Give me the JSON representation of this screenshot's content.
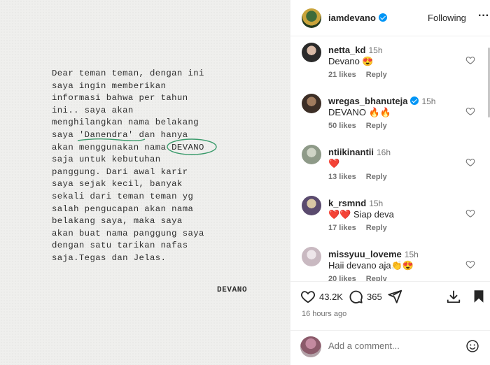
{
  "post": {
    "letter_lines": [
      "Dear teman teman, dengan ini",
      "saya ingin memberikan",
      "informasi bahwa per tahun",
      "ini.. saya akan",
      "menghilangkan nama belakang",
      "saya 'Danendra' dan hanya",
      "akan menggunakan nama DEVANO",
      "saja untuk kebutuhan",
      "panggung. Dari awal karir",
      "saya sejak kecil, banyak",
      "sekali dari teman teman yg",
      "salah pengucapan akan nama",
      "belakang saya, maka saya",
      "akan buat nama panggung saya",
      "dengan satu tarikan nafas",
      "saja.Tegas dan Jelas."
    ],
    "line6_prefix": "saya ",
    "line6_mark": "'Danendra'",
    "line6_suffix": " dan hanya",
    "line7_prefix": "akan menggunakan nama ",
    "line7_mark": "DEVANO",
    "signature": "DEVANO",
    "mark_color": "#3a9b6b"
  },
  "header": {
    "username": "iamdevano",
    "follow_label": "Following",
    "more_label": "···"
  },
  "comments": [
    {
      "user": "netta_kd",
      "verified": false,
      "time": "15h",
      "text": "Devano 😍",
      "likes": "21 likes",
      "reply": "Reply",
      "avatar_colors": [
        "#2a2a2a",
        "#d7b9a6"
      ]
    },
    {
      "user": "wregas_bhanuteja",
      "verified": true,
      "time": "15h",
      "text": "DEVANO 🔥🔥",
      "likes": "50 likes",
      "reply": "Reply",
      "avatar_colors": [
        "#3c2e26",
        "#a07b5e"
      ]
    },
    {
      "user": "ntiikinantii",
      "verified": false,
      "time": "16h",
      "text": "❤️",
      "likes": "13 likes",
      "reply": "Reply",
      "avatar_colors": [
        "#8e9a88",
        "#cfd4c6"
      ]
    },
    {
      "user": "k_rsmnd",
      "verified": false,
      "time": "15h",
      "text": "❤️❤️ Siap deva",
      "likes": "17 likes",
      "reply": "Reply",
      "avatar_colors": [
        "#5a4a6e",
        "#d8c6a4"
      ]
    },
    {
      "user": "missyuu_loveme",
      "verified": false,
      "time": "15h",
      "text": "Haii devano aja👏😍",
      "likes": "20 likes",
      "reply": "Reply",
      "avatar_colors": [
        "#c9b9c1",
        "#eee6ea"
      ]
    }
  ],
  "actions": {
    "likes_count": "43.2K",
    "comments_count": "365",
    "timestamp": "16 hours ago"
  },
  "add_comment": {
    "placeholder": "Add a comment..."
  },
  "colors": {
    "verified": "#0095f6",
    "heart_red": "#ed4956",
    "text_secondary": "#737373"
  }
}
